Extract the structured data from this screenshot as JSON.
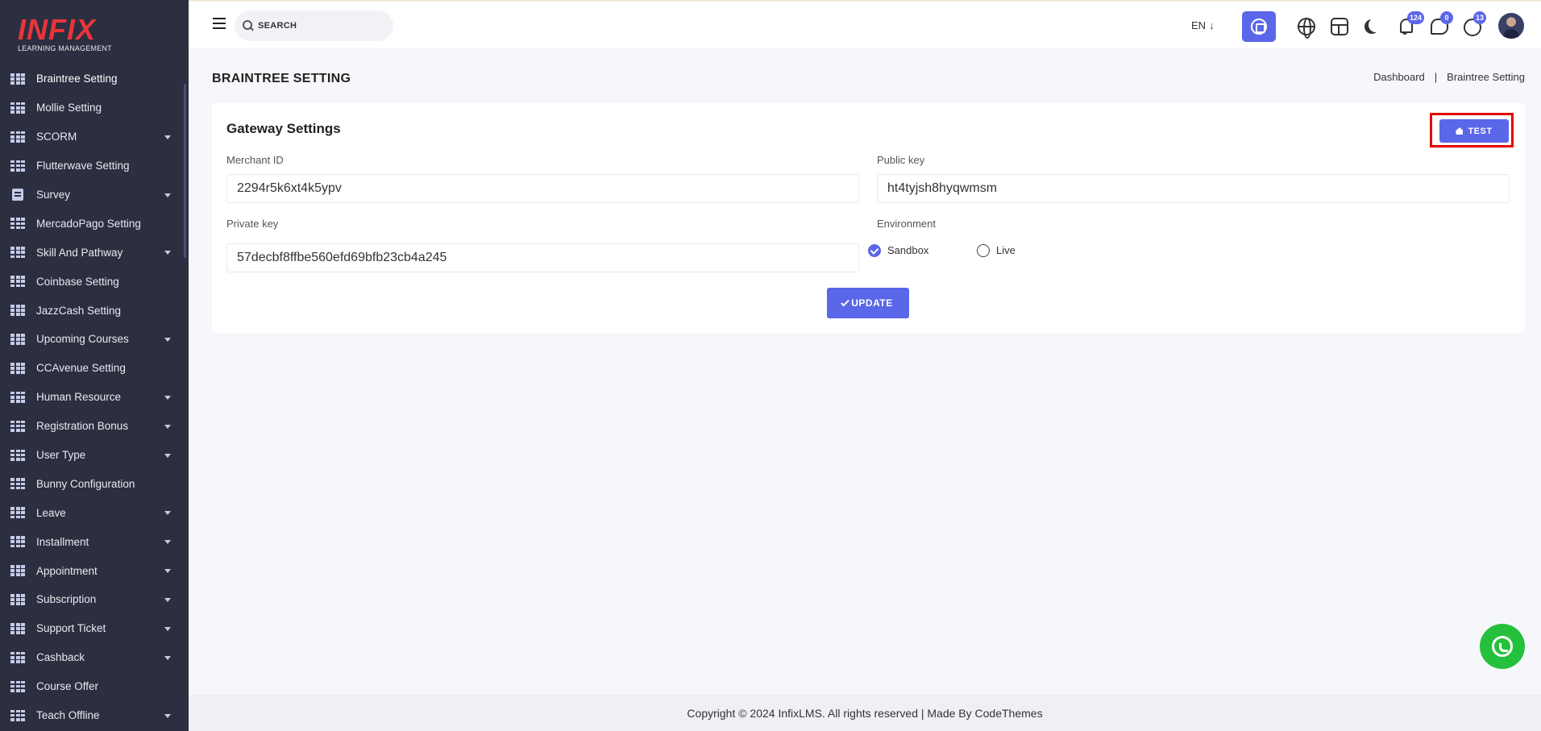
{
  "brand": {
    "logo_text": "INFIX",
    "logo_subtitle": "LEARNING MANAGEMENT"
  },
  "sidebar": {
    "items": [
      {
        "label": "Braintree Setting",
        "icon": "grid-icon",
        "has_caret": false,
        "active": true
      },
      {
        "label": "Mollie Setting",
        "icon": "grid-icon",
        "has_caret": false
      },
      {
        "label": "SCORM",
        "icon": "grid-icon",
        "has_caret": true
      },
      {
        "label": "Flutterwave Setting",
        "icon": "grid-icon",
        "has_caret": false
      },
      {
        "label": "Survey",
        "icon": "document-icon",
        "has_caret": true
      },
      {
        "label": "MercadoPago Setting",
        "icon": "grid-icon",
        "has_caret": false
      },
      {
        "label": "Skill And Pathway",
        "icon": "grid-icon",
        "has_caret": true
      },
      {
        "label": "Coinbase Setting",
        "icon": "grid-icon",
        "has_caret": false
      },
      {
        "label": "JazzCash Setting",
        "icon": "grid-icon",
        "has_caret": false
      },
      {
        "label": "Upcoming Courses",
        "icon": "grid-icon",
        "has_caret": true
      },
      {
        "label": "CCAvenue Setting",
        "icon": "grid-icon",
        "has_caret": false
      },
      {
        "label": "Human Resource",
        "icon": "grid-icon",
        "has_caret": true
      },
      {
        "label": "Registration Bonus",
        "icon": "grid-icon",
        "has_caret": true
      },
      {
        "label": "User Type",
        "icon": "grid-icon",
        "has_caret": true
      },
      {
        "label": "Bunny Configuration",
        "icon": "grid-icon",
        "has_caret": false
      },
      {
        "label": "Leave",
        "icon": "grid-icon",
        "has_caret": true
      },
      {
        "label": "Installment",
        "icon": "grid-icon",
        "has_caret": true
      },
      {
        "label": "Appointment",
        "icon": "grid-icon",
        "has_caret": true
      },
      {
        "label": "Subscription",
        "icon": "grid-icon",
        "has_caret": true
      },
      {
        "label": "Support Ticket",
        "icon": "grid-icon",
        "has_caret": true
      },
      {
        "label": "Cashback",
        "icon": "grid-icon",
        "has_caret": true
      },
      {
        "label": "Course Offer",
        "icon": "grid-icon",
        "has_caret": false
      },
      {
        "label": "Teach Offline",
        "icon": "grid-icon",
        "has_caret": true
      }
    ]
  },
  "topbar": {
    "search_placeholder": "SEARCH",
    "language": "EN",
    "language_arrow": "↓",
    "notifications_count": "124",
    "messages_count": "0",
    "whatsapp_count": "13"
  },
  "page": {
    "title": "BRAINTREE SETTING",
    "breadcrumb": [
      "Dashboard",
      "|",
      "Braintree Setting"
    ]
  },
  "card": {
    "title": "Gateway Settings",
    "test_button": "TEST",
    "merchant_id_label": "Merchant ID",
    "merchant_id_value": "2294r5k6xt4k5ypv",
    "public_key_label": "Public key",
    "public_key_value": "ht4tyjsh8hyqwmsm",
    "private_key_label": "Private key",
    "private_key_value": "57decbf8ffbe560efd69bfb23cb4a245",
    "environment_label": "Environment",
    "env_sandbox": "Sandbox",
    "env_live": "Live",
    "selected_environment": "Sandbox",
    "update_button": "UPDATE"
  },
  "footer": {
    "text": "Copyright © 2024 InfixLMS. All rights reserved | Made By CodeThemes"
  },
  "colors": {
    "accent": "#5a67e8",
    "sidebar_bg": "#2b2f40",
    "brand_red": "#e8353a",
    "highlight_red": "#e60000",
    "whatsapp_green": "#25c13c"
  }
}
